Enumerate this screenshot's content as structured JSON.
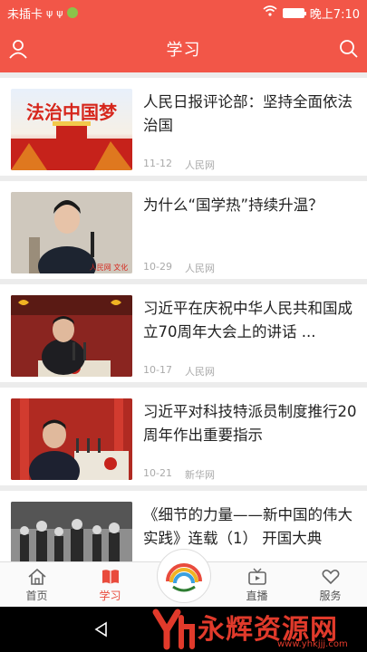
{
  "status_bar": {
    "carrier": "未插卡",
    "time": "晚上7:10"
  },
  "header": {
    "title": "学习"
  },
  "articles": [
    {
      "title": "人民日报评论部：坚持全面依法治国",
      "date": "11-12",
      "source": "人民网",
      "thumb_caption": "法治中国梦"
    },
    {
      "title": "为什么“国学热”持续升温？",
      "date": "10-29",
      "source": "人民网",
      "thumb_caption": "人民网 文化"
    },
    {
      "title": "习近平在庆祝中华人民共和国成立70周年大会上的讲话 ...",
      "date": "10-17",
      "source": "人民网"
    },
    {
      "title": "习近平对科技特派员制度推行20周年作出重要指示",
      "date": "10-21",
      "source": "新华网"
    },
    {
      "title": "《细节的力量——新中国的伟大实践》连载（1） 开国大典",
      "date": "",
      "source": ""
    }
  ],
  "tabs": [
    {
      "label": "首页"
    },
    {
      "label": "学习"
    },
    {
      "label": "直播"
    },
    {
      "label": "服务"
    }
  ],
  "watermark": {
    "text": "永辉资源网",
    "url": "www.yhkjjj.com"
  },
  "colors": {
    "brand_red": "#f25648",
    "active_tab": "#e94b3c"
  }
}
